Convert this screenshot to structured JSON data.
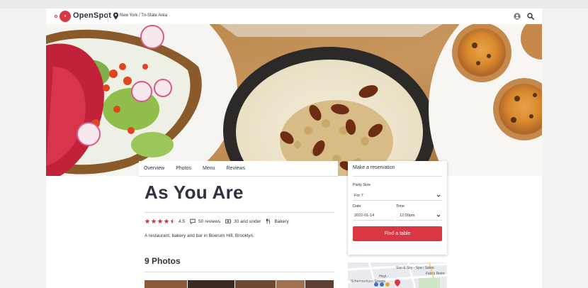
{
  "header": {
    "brand": "OpenSpot",
    "logo_mark": "s",
    "location": "New York / Tri-State Area",
    "icons": [
      "map-pin-icon",
      "user-icon",
      "search-icon"
    ]
  },
  "tabs": [
    {
      "label": "Overview"
    },
    {
      "label": "Photos"
    },
    {
      "label": "Menu"
    },
    {
      "label": "Reviews"
    }
  ],
  "restaurant": {
    "name": "As You Are",
    "rating": 4.5,
    "rating_label": "4.5",
    "stars_filled": 4.5,
    "reviews": "50 reviews",
    "price": "30 and under",
    "cuisine": "Bakery",
    "description": "A restaurant, bakery and bar in Boerum Hill, Brooklyn."
  },
  "photos": {
    "title": "9 Photos"
  },
  "reservation": {
    "title": "Make a reservation",
    "party_size_label": "Party Size",
    "party_size_value": "For 7",
    "date_label": "Date",
    "date_value": "2022-01-14",
    "time_label": "Time",
    "time_value": "12:00pm",
    "button_label": "Find a table"
  },
  "map": {
    "labels": [
      "Sun & Sky - Spa / Salon",
      "Fido's Retre",
      "Hoyt -",
      "Schermerhorn Streets"
    ]
  },
  "colors": {
    "brand": "#da3743",
    "text": "#2d333f",
    "divider": "#d8d9db"
  }
}
